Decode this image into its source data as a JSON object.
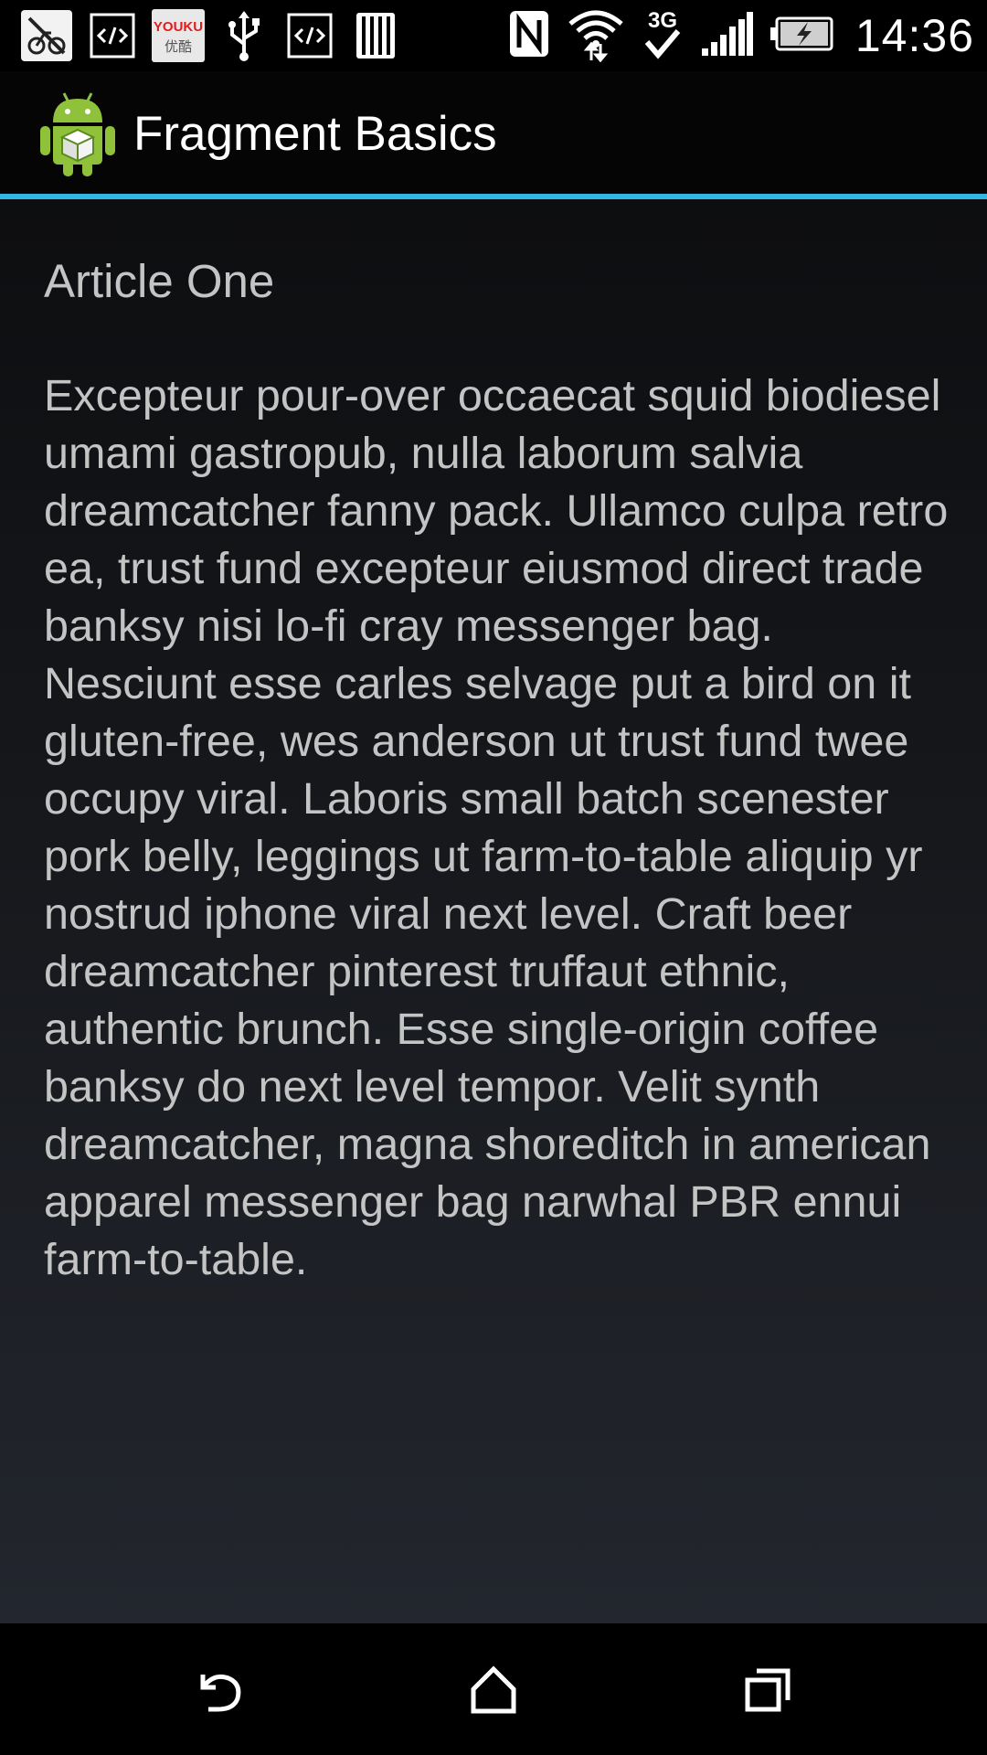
{
  "status_bar": {
    "time": "14:36",
    "notification_icons": [
      "no-bike-notification-icon",
      "code-notification-icon",
      "youku-notification-icon",
      "usb-icon",
      "code-notification-icon",
      "sd-card-icon"
    ],
    "youku_label_top": "YOUKU",
    "youku_label_bottom": "优酷",
    "network_type": "3G",
    "system_icons": [
      "nfc-icon",
      "wifi-icon",
      "3g-data-icon",
      "signal-icon",
      "battery-charging-icon"
    ]
  },
  "action_bar": {
    "title": "Fragment Basics",
    "icon": "android-app-icon",
    "accent_color": "#33b5e5"
  },
  "article": {
    "title": "Article One",
    "body": "Excepteur pour-over occaecat squid biodiesel umami gastropub, nulla laborum salvia dreamcatcher fanny pack. Ullamco culpa retro ea, trust fund excepteur eiusmod direct trade banksy nisi lo-fi cray messenger bag. Nesciunt esse carles selvage put a bird on it gluten-free, wes anderson ut trust fund twee occupy viral. Laboris small batch scenester pork belly, leggings ut farm-to-table aliquip yr nostrud iphone viral next level. Craft beer dreamcatcher pinterest truffaut ethnic, authentic brunch. Esse single-origin coffee banksy do next level tempor. Velit synth dreamcatcher, magna shoreditch in american apparel messenger bag narwhal PBR ennui farm-to-table."
  },
  "nav_bar": {
    "buttons": [
      "back-icon",
      "home-icon",
      "recent-apps-icon"
    ]
  }
}
